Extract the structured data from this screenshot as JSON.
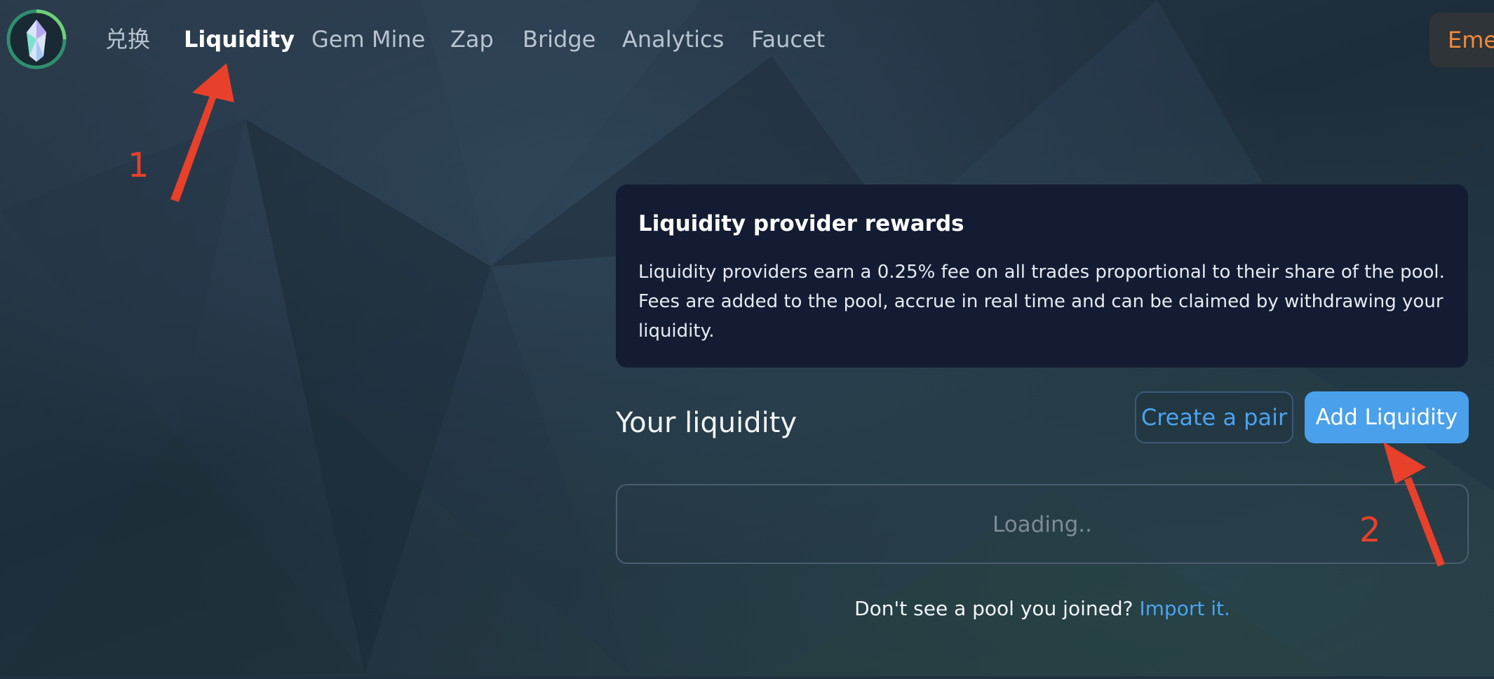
{
  "nav": {
    "logo_icon": "crystal-gem-logo-icon",
    "items": [
      {
        "label": "兑换",
        "active": false
      },
      {
        "label": "Liquidity",
        "active": true
      },
      {
        "label": "Gem Mine",
        "active": false
      },
      {
        "label": "Zap",
        "active": false
      },
      {
        "label": "Bridge",
        "active": false
      },
      {
        "label": "Analytics",
        "active": false
      },
      {
        "label": "Faucet",
        "active": false
      }
    ],
    "network_chip_label": "Emer"
  },
  "info_card": {
    "title": "Liquidity provider rewards",
    "body": "Liquidity providers earn a 0.25% fee on all trades proportional to their share of the pool. Fees are added to the pool, accrue in real time and can be claimed by withdrawing your liquidity."
  },
  "liquidity": {
    "heading": "Your liquidity",
    "create_pair_label": "Create a pair",
    "add_liquidity_label": "Add Liquidity",
    "loading_text": "Loading..",
    "import_prompt": "Don't see a pool you joined? ",
    "import_link": "Import it."
  },
  "annotations": {
    "step_1": "1",
    "step_2": "2"
  },
  "colors": {
    "accent_blue": "#4aa0ea",
    "link_blue": "#4aa3f0",
    "card_bg": "#141c33",
    "annotation_red": "#e8402a",
    "network_orange": "#f08a3c"
  }
}
